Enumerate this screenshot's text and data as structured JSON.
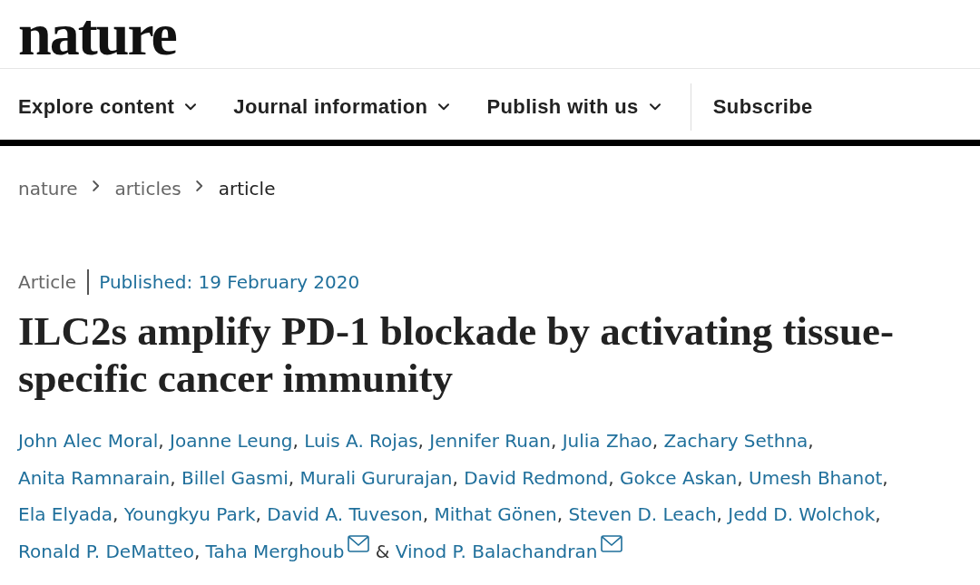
{
  "header": {
    "logo": "nature"
  },
  "nav": {
    "items": [
      {
        "label": "Explore content",
        "kind": "menu"
      },
      {
        "label": "Journal information",
        "kind": "menu"
      },
      {
        "label": "Publish with us",
        "kind": "menu"
      },
      {
        "label": "Subscribe",
        "kind": "link"
      }
    ]
  },
  "breadcrumbs": [
    {
      "label": "nature",
      "current": false
    },
    {
      "label": "articles",
      "current": false
    },
    {
      "label": "article",
      "current": true
    }
  ],
  "article": {
    "type": "Article",
    "published": "Published: 19 February 2020",
    "title": "ILC2s amplify PD-1 blockade by activating tissue-specific cancer immunity",
    "separator": ",",
    "last_separator": "&",
    "authors": [
      {
        "name": "John Alec Moral",
        "email": false
      },
      {
        "name": "Joanne Leung",
        "email": false
      },
      {
        "name": "Luis A. Rojas",
        "email": false
      },
      {
        "name": "Jennifer Ruan",
        "email": false
      },
      {
        "name": "Julia Zhao",
        "email": false
      },
      {
        "name": "Zachary Sethna",
        "email": false
      },
      {
        "name": "Anita Ramnarain",
        "email": false
      },
      {
        "name": "Billel Gasmi",
        "email": false
      },
      {
        "name": "Murali Gururajan",
        "email": false
      },
      {
        "name": "David Redmond",
        "email": false
      },
      {
        "name": "Gokce Askan",
        "email": false
      },
      {
        "name": "Umesh Bhanot",
        "email": false
      },
      {
        "name": "Ela Elyada",
        "email": false
      },
      {
        "name": "Youngkyu Park",
        "email": false
      },
      {
        "name": "David A. Tuveson",
        "email": false
      },
      {
        "name": "Mithat Gönen",
        "email": false
      },
      {
        "name": "Steven D. Leach",
        "email": false
      },
      {
        "name": "Jedd D. Wolchok",
        "email": false
      },
      {
        "name": "Ronald P. DeMatteo",
        "email": false
      },
      {
        "name": "Taha Merghoub",
        "email": true
      },
      {
        "name": "Vinod P. Balachandran",
        "email": true
      }
    ]
  }
}
